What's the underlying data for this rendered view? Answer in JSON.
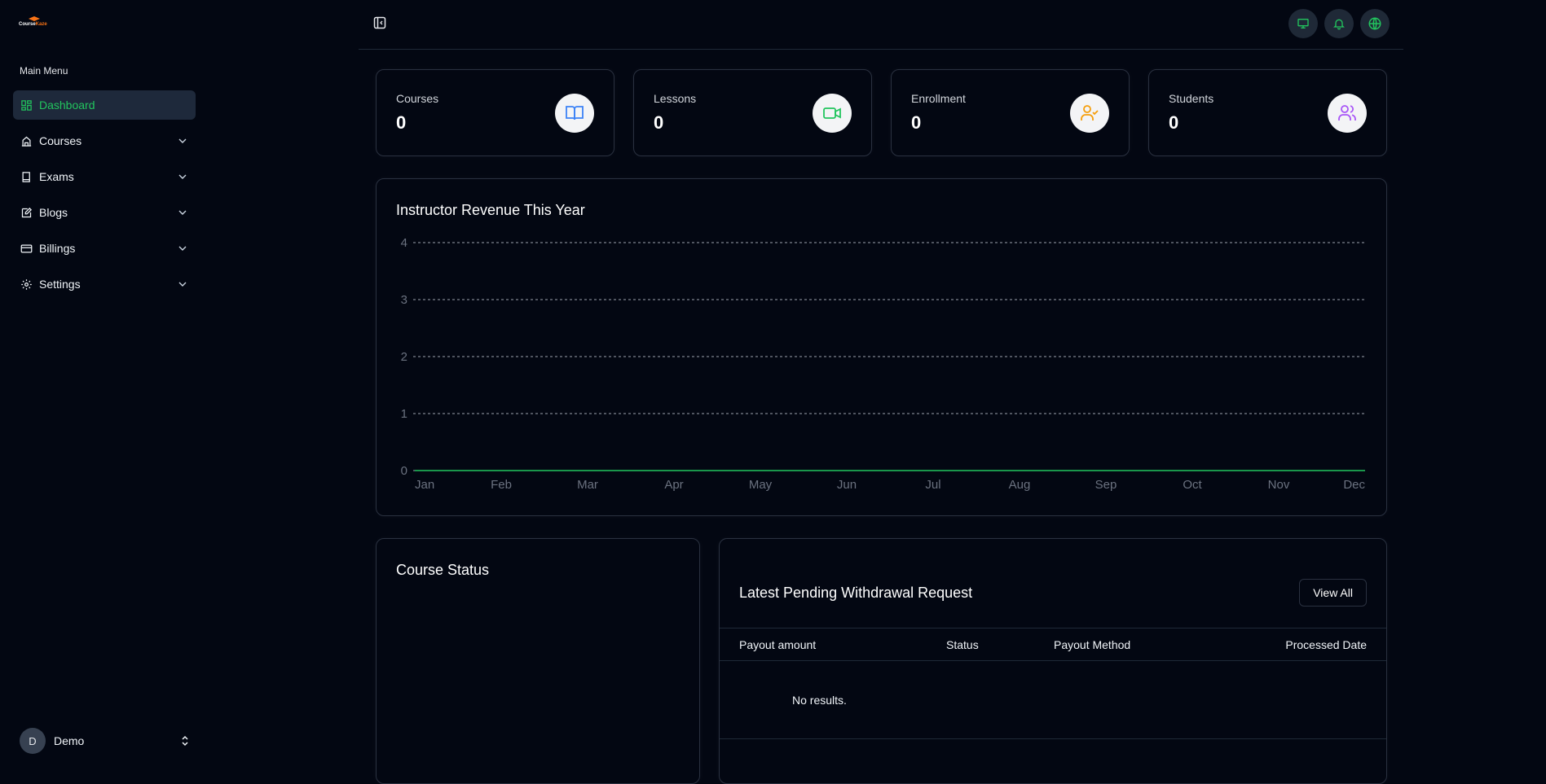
{
  "brand": {
    "name_part1": "Course",
    "name_part2": "Kaze",
    "accent": "#f97316"
  },
  "sidebar": {
    "heading": "Main Menu",
    "items": [
      {
        "label": "Dashboard",
        "icon": "dashboard-icon",
        "active": true
      },
      {
        "label": "Courses",
        "icon": "building-icon"
      },
      {
        "label": "Exams",
        "icon": "book-icon"
      },
      {
        "label": "Blogs",
        "icon": "edit-icon"
      },
      {
        "label": "Billings",
        "icon": "credit-card-icon"
      },
      {
        "label": "Settings",
        "icon": "gear-icon"
      }
    ],
    "user": {
      "initial": "D",
      "name": "Demo"
    }
  },
  "header": {
    "buttons": [
      "monitor-icon",
      "bell-icon",
      "globe-icon"
    ]
  },
  "stats": [
    {
      "label": "Courses",
      "value": "0",
      "icon": "book-open-icon",
      "color": "#3b82f6"
    },
    {
      "label": "Lessons",
      "value": "0",
      "icon": "video-icon",
      "color": "#22c55e"
    },
    {
      "label": "Enrollment",
      "value": "0",
      "icon": "user-check-icon",
      "color": "#f59e0b"
    },
    {
      "label": "Students",
      "value": "0",
      "icon": "users-icon",
      "color": "#a855f7"
    }
  ],
  "revenue_card": {
    "title": "Instructor Revenue This Year"
  },
  "chart_data": {
    "type": "line",
    "title": "Instructor Revenue This Year",
    "categories": [
      "Jan",
      "Feb",
      "Mar",
      "Apr",
      "May",
      "Jun",
      "Jul",
      "Aug",
      "Sep",
      "Oct",
      "Nov",
      "Dec"
    ],
    "series": [
      {
        "values": [
          0,
          0,
          0,
          0,
          0,
          0,
          0,
          0,
          0,
          0,
          0,
          0
        ],
        "color": "#22c55e"
      }
    ],
    "yticks": [
      "0",
      "1",
      "2",
      "3",
      "4"
    ],
    "ylim": [
      0,
      4
    ],
    "grid": true
  },
  "course_status": {
    "title": "Course Status"
  },
  "withdrawals": {
    "title": "Latest Pending Withdrawal Request",
    "view_all": "View All",
    "columns": [
      "Payout amount",
      "Status",
      "Payout Method",
      "Processed Date"
    ],
    "empty": "No results."
  }
}
